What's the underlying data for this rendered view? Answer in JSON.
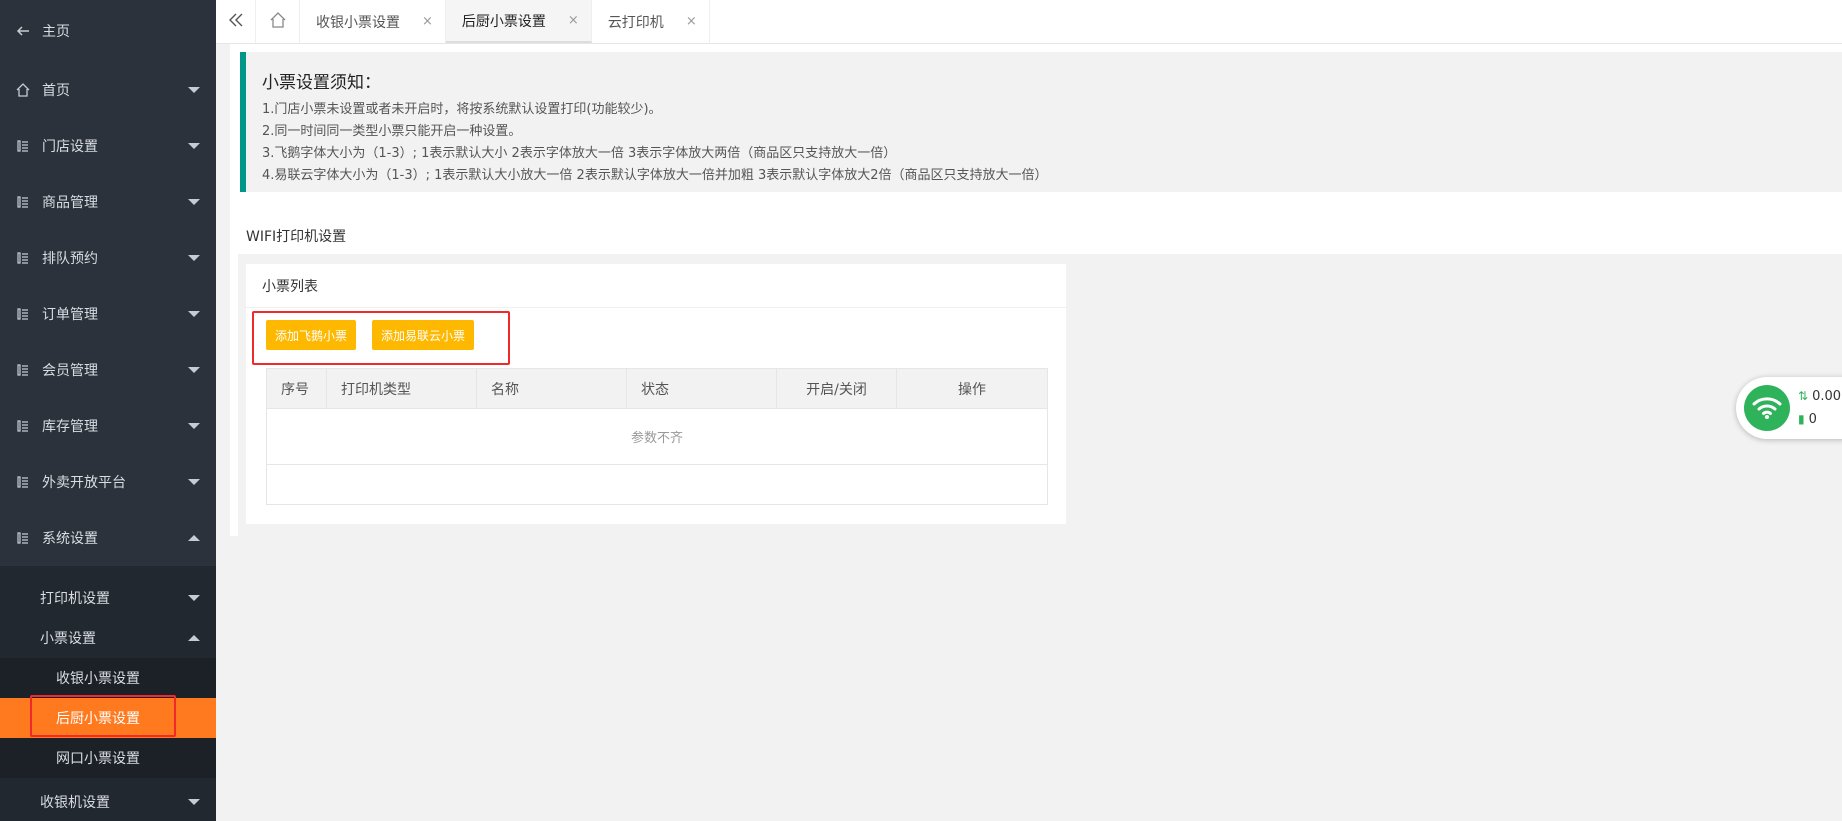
{
  "sidebar": {
    "back_label": "主页",
    "items": [
      {
        "label": "首页"
      },
      {
        "label": "门店设置"
      },
      {
        "label": "商品管理"
      },
      {
        "label": "排队预约"
      },
      {
        "label": "订单管理"
      },
      {
        "label": "会员管理"
      },
      {
        "label": "库存管理"
      },
      {
        "label": "外卖开放平台"
      },
      {
        "label": "系统设置"
      }
    ],
    "sub_items": {
      "printer": "打印机设置",
      "receipt": "小票设置",
      "cashier_device": "收银机设置"
    },
    "leaf_items": [
      {
        "label": "收银小票设置"
      },
      {
        "label": "后厨小票设置"
      },
      {
        "label": "网口小票设置"
      }
    ]
  },
  "tabs": [
    {
      "label": "收银小票设置",
      "close": "×"
    },
    {
      "label": "后厨小票设置",
      "close": "×"
    },
    {
      "label": "云打印机",
      "close": "×"
    }
  ],
  "notice": {
    "title": "小票设置须知：",
    "lines": [
      "1.门店小票未设置或者未开启时，将按系统默认设置打印(功能较少)。",
      "2.同一时间同一类型小票只能开启一种设置。",
      "3.飞鹅字体大小为（1-3）; 1表示默认大小 2表示字体放大一倍 3表示字体放大两倍（商品区只支持放大一倍）",
      "4.易联云字体大小为（1-3）; 1表示默认大小放大一倍 2表示默认字体放大一倍并加粗 3表示默认字体放大2倍（商品区只支持放大一倍）"
    ]
  },
  "wifi_section_title": "WIFI打印机设置",
  "receipt_list": {
    "title": "小票列表",
    "add_feie_label": "添加飞鹅小票",
    "add_yilianyun_label": "添加易联云小票",
    "columns": [
      "序号",
      "打印机类型",
      "名称",
      "状态",
      "开启/关闭",
      "操作"
    ],
    "empty_text": "参数不齐"
  },
  "net_widget": {
    "speed": "0.00",
    "count": "0"
  },
  "colors": {
    "sidebar_bg": "#2b323b",
    "active_orange": "#ff7a1f",
    "button_yellow": "#ffb800",
    "notice_border": "#009688",
    "highlight_red": "#f02a2a",
    "wifi_green": "#2fb35a"
  }
}
